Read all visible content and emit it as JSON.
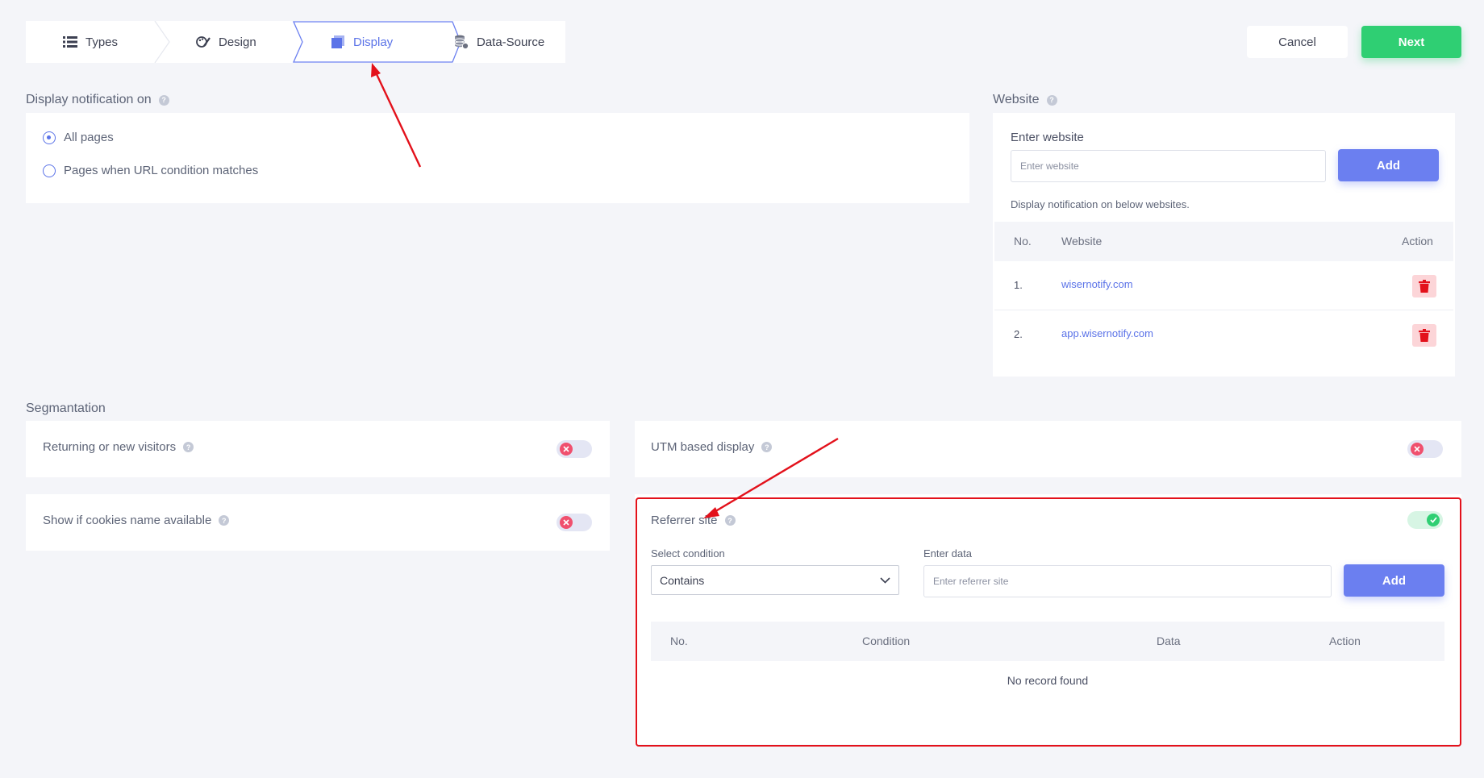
{
  "stepper": {
    "steps": [
      {
        "label": "Types",
        "icon": "list-icon"
      },
      {
        "label": "Design",
        "icon": "palette-icon"
      },
      {
        "label": "Display",
        "icon": "display-icon",
        "active": true
      },
      {
        "label": "Data-Source",
        "icon": "database-icon"
      }
    ]
  },
  "actions": {
    "cancel_label": "Cancel",
    "next_label": "Next"
  },
  "display_on": {
    "title": "Display notification on",
    "options": [
      {
        "label": "All pages",
        "selected": true
      },
      {
        "label": "Pages when URL condition matches",
        "selected": false
      }
    ]
  },
  "website": {
    "title": "Website",
    "input_label": "Enter website",
    "input_placeholder": "Enter website",
    "add_label": "Add",
    "note": "Display notification on below websites.",
    "columns": [
      "No.",
      "Website",
      "Action"
    ],
    "rows": [
      {
        "no": "1.",
        "site": "wisernotify.com"
      },
      {
        "no": "2.",
        "site": "app.wisernotify.com"
      }
    ]
  },
  "segmentation": {
    "title": "Segmantation",
    "returning": {
      "label": "Returning or new visitors",
      "enabled": false
    },
    "utm": {
      "label": "UTM based display",
      "enabled": false
    },
    "cookies": {
      "label": "Show if cookies name available",
      "enabled": false
    },
    "referrer": {
      "label": "Referrer site",
      "enabled": true,
      "condition_label": "Select condition",
      "condition_value": "Contains",
      "data_label": "Enter data",
      "data_placeholder": "Enter referrer site",
      "add_label": "Add",
      "columns": [
        "No.",
        "Condition",
        "Data",
        "Action"
      ],
      "empty_text": "No record found"
    }
  },
  "colors": {
    "accent": "#5b73e8",
    "next_green": "#2fcf73",
    "annotation_red": "#e3111b"
  }
}
